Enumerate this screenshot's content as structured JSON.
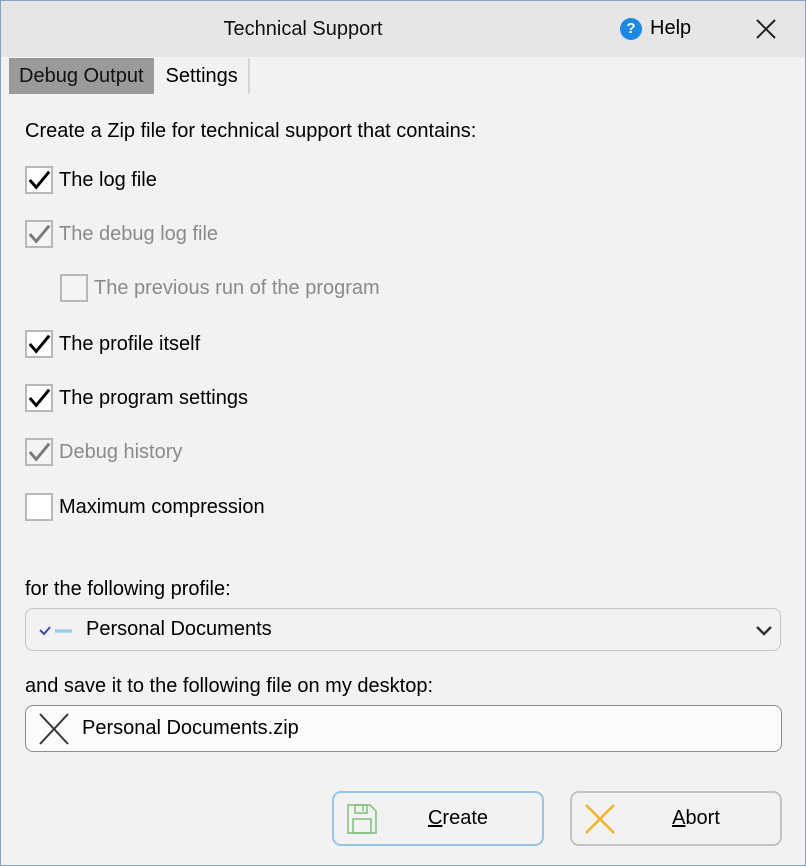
{
  "window": {
    "title": "Technical Support",
    "help_label": "Help",
    "help_icon": "question-circle-icon",
    "close_icon": "close-icon"
  },
  "tabs": [
    {
      "label": "Debug Output",
      "active": true
    },
    {
      "label": "Settings",
      "active": false
    }
  ],
  "intro": "Create a Zip file for technical support that contains:",
  "options": [
    {
      "label": "The log file",
      "checked": true,
      "disabled": false
    },
    {
      "label": "The debug log file",
      "checked": true,
      "disabled": true
    },
    {
      "label": "The previous run of the program",
      "checked": false,
      "disabled": true
    },
    {
      "label": "The profile itself",
      "checked": true,
      "disabled": false
    },
    {
      "label": "The program settings",
      "checked": true,
      "disabled": false
    },
    {
      "label": "Debug history",
      "checked": true,
      "disabled": true
    },
    {
      "label": "Maximum compression",
      "checked": false,
      "disabled": false
    }
  ],
  "profile": {
    "label": "for the following profile:",
    "selected": "Personal Documents",
    "icon": "profile-sync-icon"
  },
  "file": {
    "label": "and save it to the following file on my desktop:",
    "value": "Personal Documents.zip",
    "clear_icon": "clear-icon"
  },
  "buttons": {
    "create": {
      "mnemonic": "C",
      "rest": "reate",
      "icon": "save-icon"
    },
    "abort": {
      "mnemonic": "A",
      "rest": "bort",
      "icon": "abort-icon"
    }
  },
  "colors": {
    "accent_blue": "#1e88e5",
    "create_border": "#96c4ec",
    "save_icon_green": "#7cc07c",
    "abort_icon_orange": "#f5b030",
    "active_tab": "#9a9a9a"
  }
}
